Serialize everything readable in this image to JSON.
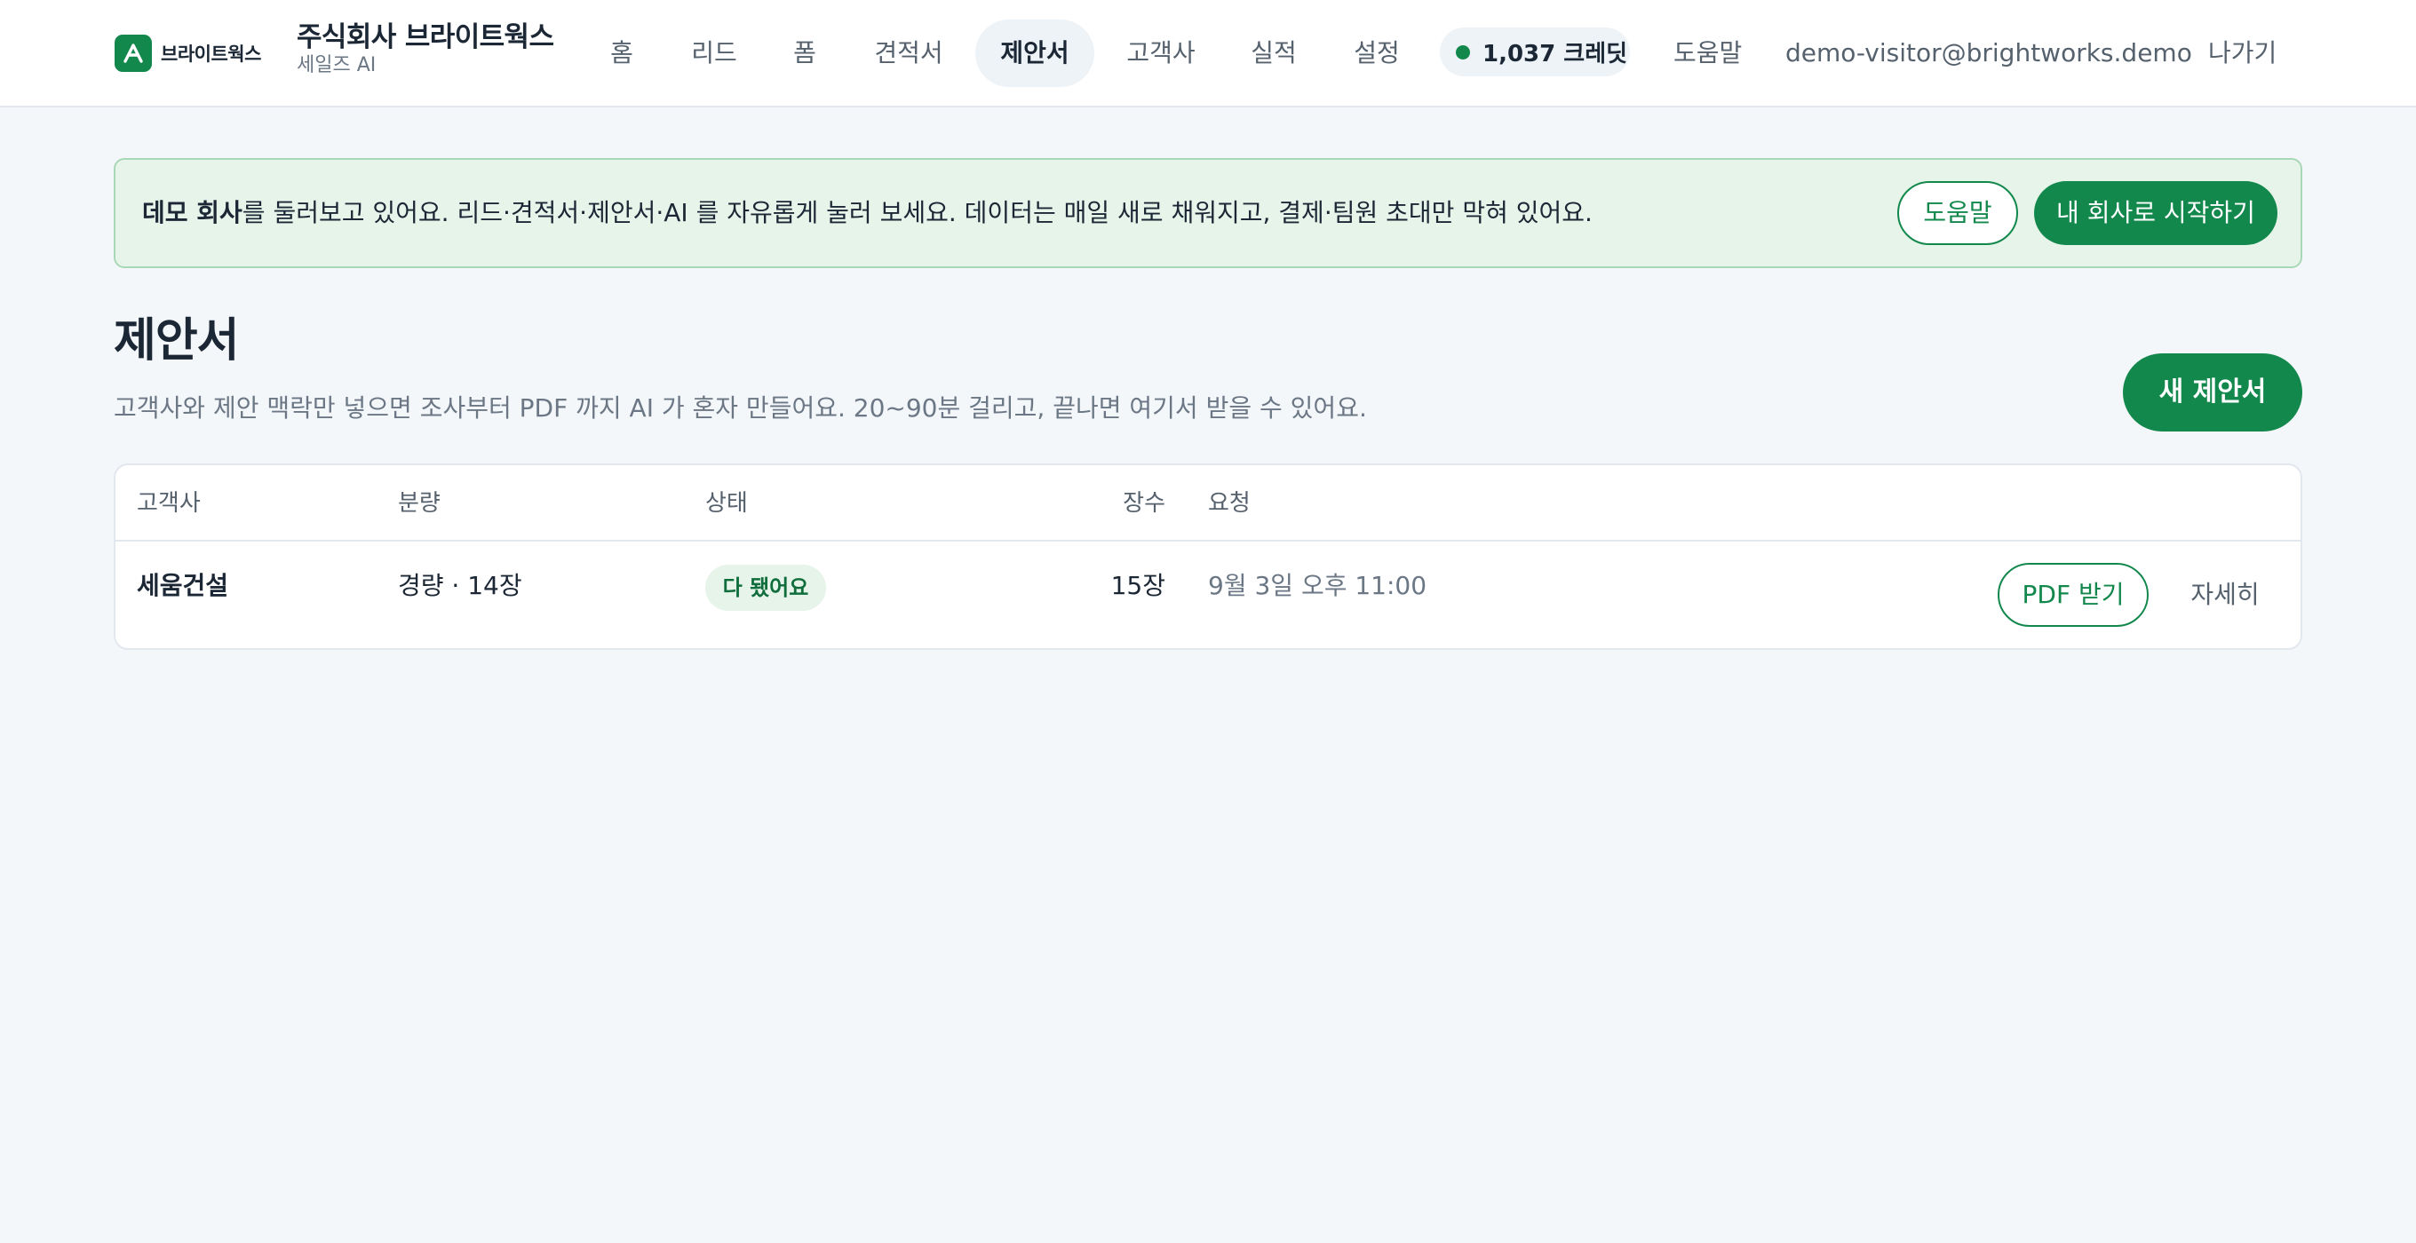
{
  "header": {
    "logo_text": "브라이트웍스",
    "company_name": "주식회사 브라이트웍스",
    "company_sub": "세일즈 AI",
    "nav": [
      {
        "label": "홈"
      },
      {
        "label": "리드"
      },
      {
        "label": "폼"
      },
      {
        "label": "견적서"
      },
      {
        "label": "제안서"
      },
      {
        "label": "고객사"
      },
      {
        "label": "실적"
      },
      {
        "label": "설정"
      }
    ],
    "active_nav": "제안서",
    "credit": "1,037 크레딧",
    "help": "도움말",
    "user_email": "demo-visitor@brightworks.demo",
    "logout": "나가기"
  },
  "banner": {
    "bold": "데모 회사",
    "text": "를 둘러보고 있어요. 리드·견적서·제안서·AI 를 자유롭게 눌러 보세요. 데이터는 매일 새로 채워지고, 결제·팀원 초대만 막혀 있어요.",
    "help_button": "도움말",
    "start_button": "내 회사로 시작하기"
  },
  "page": {
    "title": "제안서",
    "description": "고객사와 제안 맥락만 넣으면 조사부터 PDF 까지 AI 가 혼자 만들어요. 20~90분 걸리고, 끝나면 여기서 받을 수 있어요.",
    "new_button": "새 제안서"
  },
  "table": {
    "columns": {
      "client": "고객사",
      "volume": "분량",
      "status": "상태",
      "pages": "장수",
      "requested": "요청"
    },
    "rows": [
      {
        "client": "세움건설",
        "volume": "경량 · 14장",
        "status": "다 됐어요",
        "pages": "15장",
        "requested": "9월 3일 오후 11:00",
        "pdf_button": "PDF 받기",
        "detail_button": "자세히"
      }
    ]
  },
  "colors": {
    "accent": "#13884c",
    "background": "#f4f7fa",
    "banner_bg": "#e6f4ea"
  }
}
